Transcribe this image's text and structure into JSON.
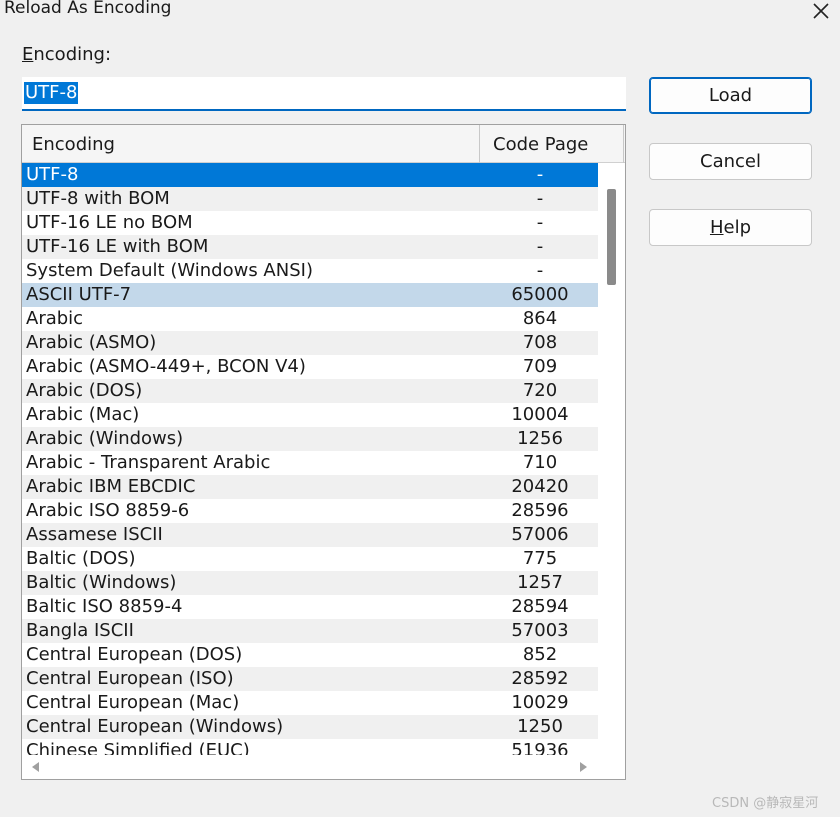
{
  "window": {
    "title": "Reload As Encoding"
  },
  "encoding_field": {
    "label_accel": "E",
    "label_rest": "ncoding:",
    "value": "UTF-8"
  },
  "buttons": {
    "load": "Load",
    "cancel": "Cancel",
    "help_accel": "H",
    "help_rest": "elp"
  },
  "list": {
    "columns": [
      "Encoding",
      "Code Page"
    ],
    "selected_index": 0,
    "hover_index": 5,
    "rows": [
      {
        "name": "UTF-8",
        "code_page": "-"
      },
      {
        "name": "UTF-8 with BOM",
        "code_page": "-"
      },
      {
        "name": "UTF-16 LE no BOM",
        "code_page": "-"
      },
      {
        "name": "UTF-16 LE with BOM",
        "code_page": "-"
      },
      {
        "name": "System Default (Windows ANSI)",
        "code_page": "-"
      },
      {
        "name": "ASCII UTF-7",
        "code_page": "65000"
      },
      {
        "name": "Arabic",
        "code_page": "864"
      },
      {
        "name": "Arabic (ASMO)",
        "code_page": "708"
      },
      {
        "name": "Arabic (ASMO-449+, BCON V4)",
        "code_page": "709"
      },
      {
        "name": "Arabic (DOS)",
        "code_page": "720"
      },
      {
        "name": "Arabic (Mac)",
        "code_page": "10004"
      },
      {
        "name": "Arabic (Windows)",
        "code_page": "1256"
      },
      {
        "name": "Arabic - Transparent Arabic",
        "code_page": "710"
      },
      {
        "name": "Arabic IBM EBCDIC",
        "code_page": "20420"
      },
      {
        "name": "Arabic ISO 8859-6",
        "code_page": "28596"
      },
      {
        "name": "Assamese ISCII",
        "code_page": "57006"
      },
      {
        "name": "Baltic (DOS)",
        "code_page": "775"
      },
      {
        "name": "Baltic (Windows)",
        "code_page": "1257"
      },
      {
        "name": "Baltic ISO 8859-4",
        "code_page": "28594"
      },
      {
        "name": "Bangla ISCII",
        "code_page": "57003"
      },
      {
        "name": "Central European (DOS)",
        "code_page": "852"
      },
      {
        "name": "Central European (ISO)",
        "code_page": "28592"
      },
      {
        "name": "Central European (Mac)",
        "code_page": "10029"
      },
      {
        "name": "Central European (Windows)",
        "code_page": "1250"
      },
      {
        "name": "Chinese Simplified (EUC)",
        "code_page": "51936"
      }
    ]
  },
  "watermark": "CSDN @静寂星河",
  "icons": {
    "close": "close-icon",
    "scroll_left": "scroll-left-arrow-icon",
    "scroll_right": "scroll-right-arrow-icon"
  }
}
